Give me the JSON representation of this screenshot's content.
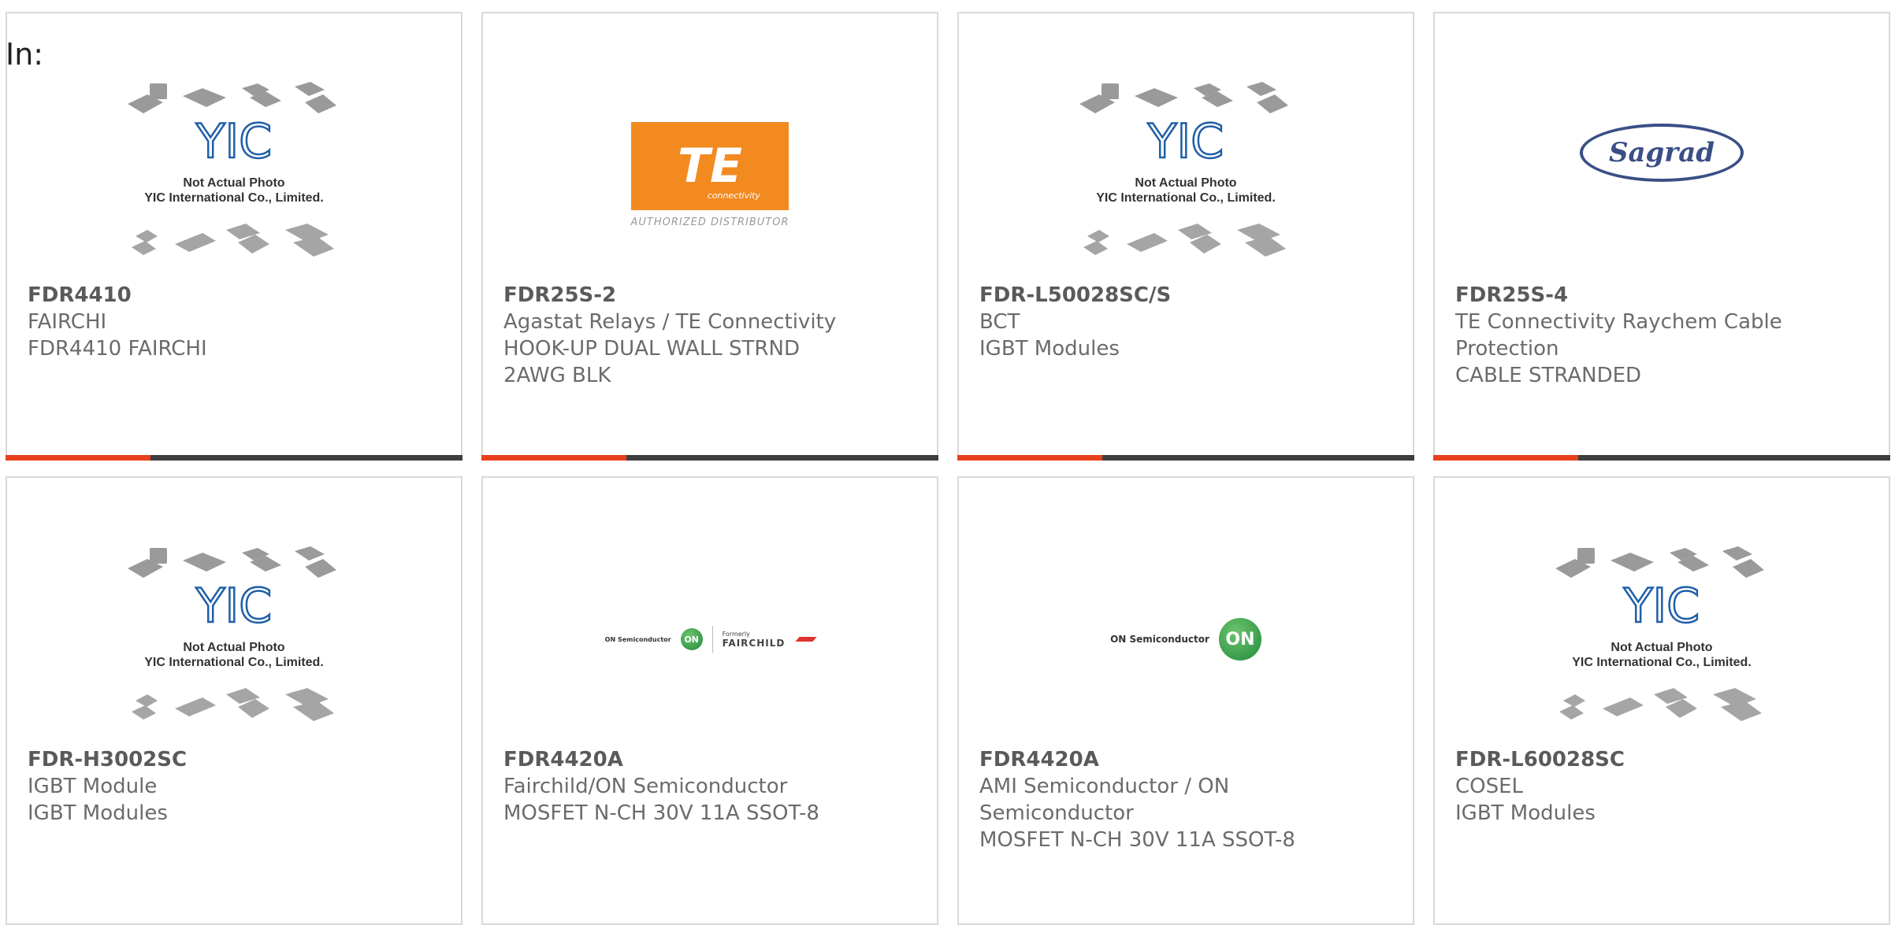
{
  "header": {
    "in_label": "In:"
  },
  "placeholder": {
    "line1": "Not Actual Photo",
    "line2": "YIC International Co., Limited.",
    "logo_text": "YIC"
  },
  "logos": {
    "te_mark": "TE",
    "te_sub": "connectivity",
    "te_distributor": "AUTHORIZED DISTRIBUTOR",
    "sagrad": "Sagrad",
    "on_semi_text": "ON Semiconductor",
    "on_mark": "ON",
    "fairchild_formerly": "Formerly",
    "fairchild_name": "FAIRCHILD"
  },
  "colors": {
    "accent": "#e8401c",
    "bar": "#3e3e3e",
    "border": "#d9d9d9",
    "te_orange": "#f28a20",
    "on_green": "#1f8a3a",
    "yic_blue": "#1f5fa8"
  },
  "products": [
    {
      "part": "FDR4410",
      "lines": [
        "FAIRCHI",
        "FDR4410 FAIRCHI"
      ],
      "image": "yic-placeholder"
    },
    {
      "part": "FDR25S-2",
      "lines": [
        "Agastat Relays / TE Connectivity",
        "HOOK-UP DUAL WALL STRND",
        "2AWG BLK"
      ],
      "image": "te-logo"
    },
    {
      "part": "FDR-L50028SC/S",
      "lines": [
        "BCT",
        "IGBT Modules"
      ],
      "image": "yic-placeholder"
    },
    {
      "part": "FDR25S-4",
      "lines": [
        "TE Connectivity Raychem Cable",
        "Protection",
        "CABLE STRANDED"
      ],
      "image": "sagrad-logo"
    },
    {
      "part": "FDR-H3002SC",
      "lines": [
        "IGBT Module",
        "IGBT Modules"
      ],
      "image": "yic-placeholder"
    },
    {
      "part": "FDR4420A",
      "lines": [
        "Fairchild/ON Semiconductor",
        "MOSFET N-CH 30V 11A SSOT-8"
      ],
      "image": "on-fairchild-logo"
    },
    {
      "part": "FDR4420A",
      "lines": [
        "AMI Semiconductor / ON",
        "Semiconductor",
        "MOSFET N-CH 30V 11A SSOT-8"
      ],
      "image": "on-semi-logo"
    },
    {
      "part": "FDR-L60028SC",
      "lines": [
        "COSEL",
        "IGBT Modules"
      ],
      "image": "yic-placeholder"
    }
  ]
}
